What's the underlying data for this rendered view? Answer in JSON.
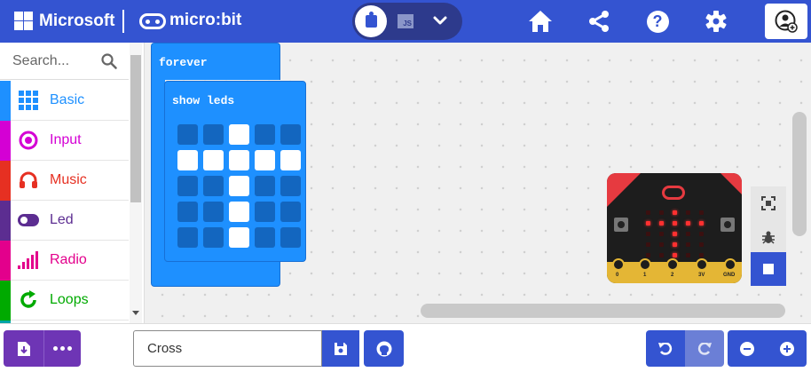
{
  "header": {
    "brand": "Microsoft",
    "product": "micro:bit",
    "toggle": {
      "blocks": "blocks-icon",
      "js_label": "JS",
      "more": "chevron-down-icon"
    },
    "icons": [
      "home-icon",
      "share-icon",
      "help-icon",
      "settings-icon",
      "user-icon"
    ],
    "help_glyph": "?"
  },
  "sidebar": {
    "search_placeholder": "Search...",
    "categories": [
      {
        "label": "Basic",
        "color": "#1e90ff",
        "icon": "grid-icon"
      },
      {
        "label": "Input",
        "color": "#d400d4",
        "icon": "target-icon"
      },
      {
        "label": "Music",
        "color": "#e63022",
        "icon": "headphones-icon"
      },
      {
        "label": "Led",
        "color": "#5c2d91",
        "icon": "toggle-icon"
      },
      {
        "label": "Radio",
        "color": "#e3008c",
        "icon": "signal-bars-icon"
      },
      {
        "label": "Loops",
        "color": "#00aa00",
        "icon": "refresh-icon"
      }
    ]
  },
  "workspace": {
    "forever_label": "forever",
    "show_leds_label": "show leds",
    "leds": [
      [
        0,
        0,
        1,
        0,
        0
      ],
      [
        1,
        1,
        1,
        1,
        1
      ],
      [
        0,
        0,
        1,
        0,
        0
      ],
      [
        0,
        0,
        1,
        0,
        0
      ],
      [
        0,
        0,
        1,
        0,
        0
      ]
    ]
  },
  "simulator": {
    "pins": [
      "0",
      "1",
      "2",
      "3V",
      "GND"
    ],
    "tools": [
      "fullscreen-icon",
      "debug-icon",
      "stop-icon"
    ]
  },
  "footer": {
    "project_name": "Cross"
  }
}
